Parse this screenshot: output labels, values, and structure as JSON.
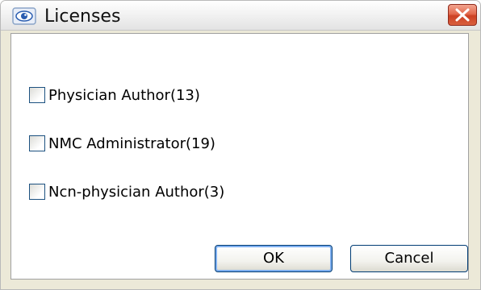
{
  "window": {
    "title": "Licenses",
    "icon": "eye-icon",
    "close_icon": "close-icon"
  },
  "options": [
    {
      "label": "Physician Author(13)",
      "checked": false
    },
    {
      "label": "NMC Administrator(19)",
      "checked": false
    },
    {
      "label": "Ncn-physician Author(3)",
      "checked": false
    }
  ],
  "buttons": {
    "ok_label": "OK",
    "cancel_label": "Cancel"
  },
  "colors": {
    "close_button": "#d9603f",
    "focus_ring": "#7eaff0",
    "checkbox_border": "#1c5180"
  }
}
